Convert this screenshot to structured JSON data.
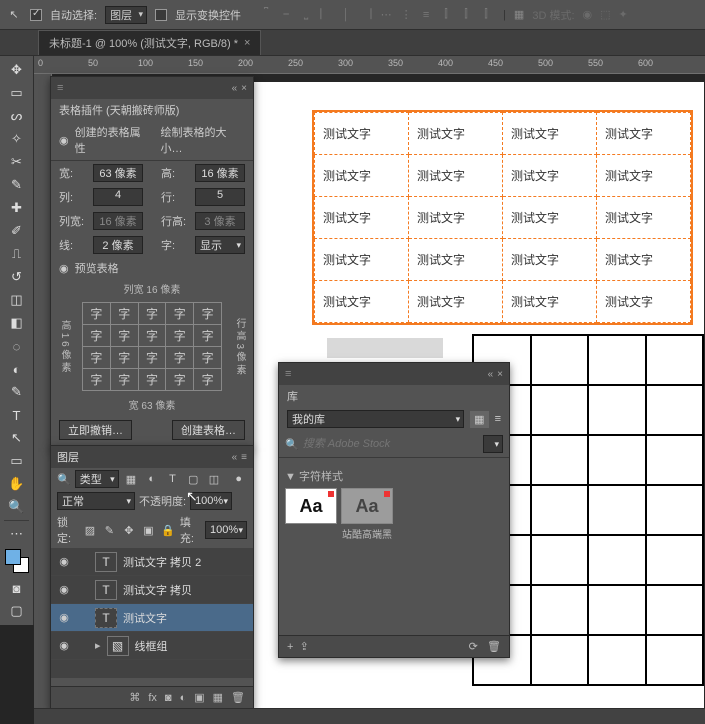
{
  "optbar": {
    "move_icon": "↖",
    "auto_select_label": "自动选择:",
    "auto_select_target": "图层",
    "show_transform_label": "显示变换控件",
    "mode_3d": "3D 模式:"
  },
  "doctab": {
    "title": "未标题-1 @ 100% (测试文字, RGB/8) *"
  },
  "ruler_marks": [
    "0",
    "50",
    "100",
    "150",
    "200",
    "250",
    "300",
    "350",
    "400",
    "450",
    "500",
    "550",
    "600"
  ],
  "artboard": {
    "cell_text": "测试文字",
    "rows": 5,
    "cols": 4,
    "wire_rows": 7,
    "wire_cols": 4
  },
  "plugin": {
    "title": "表格插件 (天朝搬砖师版)",
    "tab_props": "创建的表格属性",
    "tab_size": "绘制表格的大小…",
    "labels": {
      "width": "宽:",
      "height": "高:",
      "cols": "列:",
      "rows": "行:",
      "colw": "列宽:",
      "rowh": "行高:",
      "line": "线:",
      "font": "字:",
      "preview": "预览表格"
    },
    "values": {
      "width": "63 像素",
      "height": "16 像素",
      "cols": "4",
      "rows": "5",
      "colw": "16 像素",
      "rowh": "3 像素",
      "line": "2 像素",
      "font": "显示"
    },
    "preview_collabel": "列宽 16 像素",
    "preview_heightlabel": "高 1 6 像 素",
    "preview_rowhlabel": "行 高 3 像 素",
    "preview_widthlabel": "宽 63 像素",
    "preview_cell": "字",
    "btn_undo": "立即撤销…",
    "btn_create": "创建表格…"
  },
  "layers": {
    "title": "图层",
    "filter_kind": "类型",
    "blend": "正常",
    "opacity_label": "不透明度:",
    "opacity_val": "100%",
    "lock_label": "锁定:",
    "fill_label": "填充:",
    "fill_val": "100%",
    "items": [
      {
        "name": "测试文字 拷贝 2",
        "type": "T"
      },
      {
        "name": "测试文字 拷贝",
        "type": "T"
      },
      {
        "name": "测试文字",
        "type": "T",
        "active": true
      },
      {
        "name": "线框组",
        "type": "folder"
      }
    ]
  },
  "library": {
    "title": "库",
    "lib_name": "我的库",
    "search_ph": "搜索 Adobe Stock",
    "section": "▼ 字符样式",
    "items": [
      {
        "glyph": "Aa",
        "cap": ""
      },
      {
        "glyph": "Aa",
        "cap": "站酷高端黑",
        "dark": true
      }
    ]
  }
}
